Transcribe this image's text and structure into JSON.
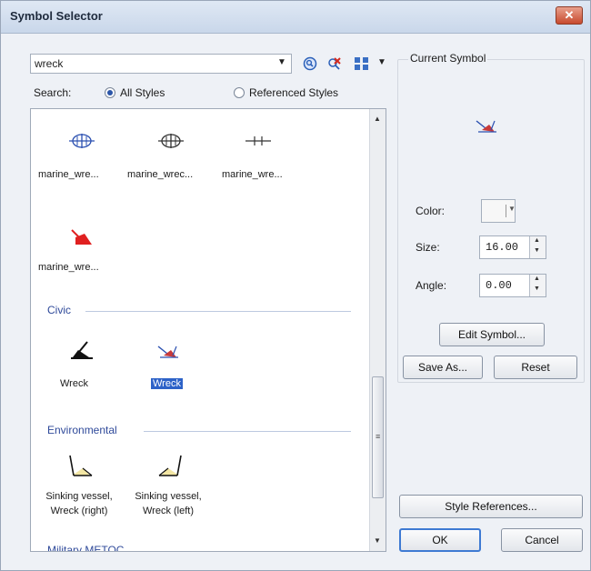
{
  "window": {
    "title": "Symbol Selector",
    "close_label": "✕"
  },
  "search": {
    "value": "wreck"
  },
  "scope": {
    "label": "Search:",
    "options": [
      "All Styles",
      "Referenced Styles"
    ],
    "selected": "All Styles"
  },
  "results": {
    "marine_row1": [
      "marine_wre...",
      "marine_wrec...",
      "marine_wre..."
    ],
    "marine_row2": [
      "marine_wre..."
    ],
    "categories": [
      "Civic",
      "Environmental",
      "Military METOC"
    ],
    "civic_items": [
      "Wreck",
      "Wreck"
    ],
    "environmental_items": [
      {
        "line1": "Sinking vessel,",
        "line2": "Wreck (right)"
      },
      {
        "line1": "Sinking vessel,",
        "line2": "Wreck (left)"
      }
    ],
    "selected_item": "Wreck"
  },
  "current_symbol": {
    "group_title": "Current Symbol",
    "color_label": "Color:",
    "size_label": "Size:",
    "size_value": "16.00",
    "angle_label": "Angle:",
    "angle_value": "0.00"
  },
  "buttons": {
    "edit_symbol": "Edit Symbol...",
    "save_as": "Save As...",
    "reset": "Reset",
    "style_references": "Style References...",
    "ok": "OK",
    "cancel": "Cancel"
  },
  "colors": {
    "accent": "#2d62c8",
    "category": "#2f4a9a",
    "red_symbol": "#e02020"
  }
}
